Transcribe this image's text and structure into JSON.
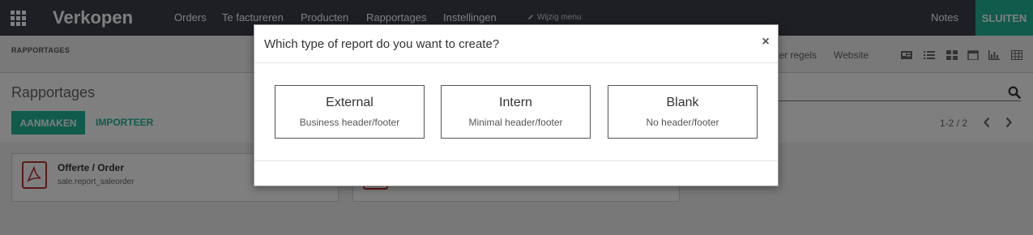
{
  "navbar": {
    "brand": "Verkopen",
    "menu": [
      "Orders",
      "Te factureren",
      "Producten",
      "Rapportages",
      "Instellingen"
    ],
    "edit_menu": "Wijzig menu",
    "notes": "Notes",
    "close": "SLUITEN"
  },
  "subbar": {
    "title": "RAPPORTAGES",
    "filters": [
      "ter regels",
      "Website"
    ]
  },
  "control": {
    "page_title": "Rapportages",
    "create": "AANMAKEN",
    "import": "IMPORTEER",
    "pager": "1-2 / 2"
  },
  "cards": [
    {
      "title": "Offerte / Order",
      "subtitle": "sale.report_saleorder"
    }
  ],
  "modal": {
    "title": "Which type of report do you want to create?",
    "close": "×",
    "options": [
      {
        "title": "External",
        "subtitle": "Business header/footer"
      },
      {
        "title": "Intern",
        "subtitle": "Minimal header/footer"
      },
      {
        "title": "Blank",
        "subtitle": "No header/footer"
      }
    ]
  },
  "colors": {
    "navbar": "#3a3f4b",
    "accent": "#21b799",
    "pdf_red": "#b33333"
  },
  "icons": [
    "apps-grid-icon",
    "pencil-icon",
    "kanban-view-icon",
    "list-view-icon",
    "grid-view-icon",
    "calendar-view-icon",
    "graph-view-icon",
    "pivot-view-icon",
    "search-icon",
    "chevron-left-icon",
    "chevron-right-icon",
    "pdf-icon"
  ]
}
